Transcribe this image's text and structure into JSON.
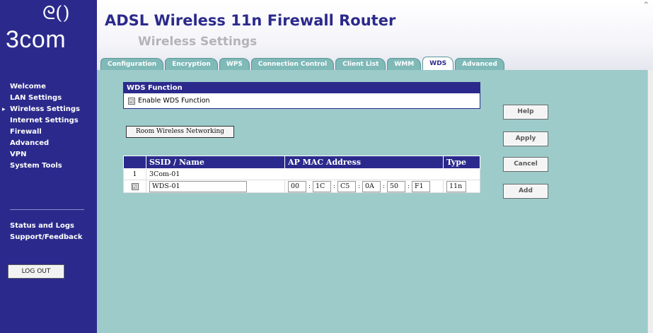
{
  "brand": {
    "logo_glyph": "ᘓ()",
    "logo_text": "3com"
  },
  "header": {
    "title": "ADSL Wireless 11n Firewall Router",
    "section": "Wireless Settings"
  },
  "tabs": [
    {
      "label": "Configuration"
    },
    {
      "label": "Encryption"
    },
    {
      "label": "WPS"
    },
    {
      "label": "Connection Control"
    },
    {
      "label": "Client List"
    },
    {
      "label": "WMM"
    },
    {
      "label": "WDS",
      "active": true
    },
    {
      "label": "Advanced"
    }
  ],
  "nav": {
    "items": [
      {
        "label": "Welcome"
      },
      {
        "label": "LAN Settings"
      },
      {
        "label": "Wireless Settings",
        "current": true
      },
      {
        "label": "Internet Settings"
      },
      {
        "label": "Firewall"
      },
      {
        "label": "Advanced"
      },
      {
        "label": "VPN"
      },
      {
        "label": "System Tools"
      }
    ],
    "bottom_items": [
      {
        "label": "Status and Logs"
      },
      {
        "label": "Support/Feedback"
      }
    ],
    "logout_label": "LOG OUT",
    "current_marker": "▸"
  },
  "wds": {
    "heading": "WDS Function",
    "enable_label": "Enable WDS Function",
    "enabled": true
  },
  "room_button_label": "Room Wireless Networking",
  "table": {
    "headers": [
      "",
      "SSID / Name",
      "AP MAC Address",
      "Type"
    ],
    "existing_row": {
      "index": "1",
      "ssid": "3Com-01"
    },
    "new_row": {
      "checked": true,
      "ssid": "WDS-01",
      "mac": [
        "00",
        "1C",
        "C5",
        "0A",
        "50",
        "F1"
      ],
      "separator": ":",
      "type": "11n"
    }
  },
  "buttons": {
    "help": "Help",
    "apply": "Apply",
    "cancel": "Cancel",
    "add": "Add"
  },
  "colors": {
    "nav_bg": "#2b2a8c",
    "content_bg": "#9ccbca",
    "tab_bg": "#7fb9b8",
    "title": "#2c2a8b"
  },
  "icons": {
    "check": "☑",
    "scroll_up": "^"
  }
}
